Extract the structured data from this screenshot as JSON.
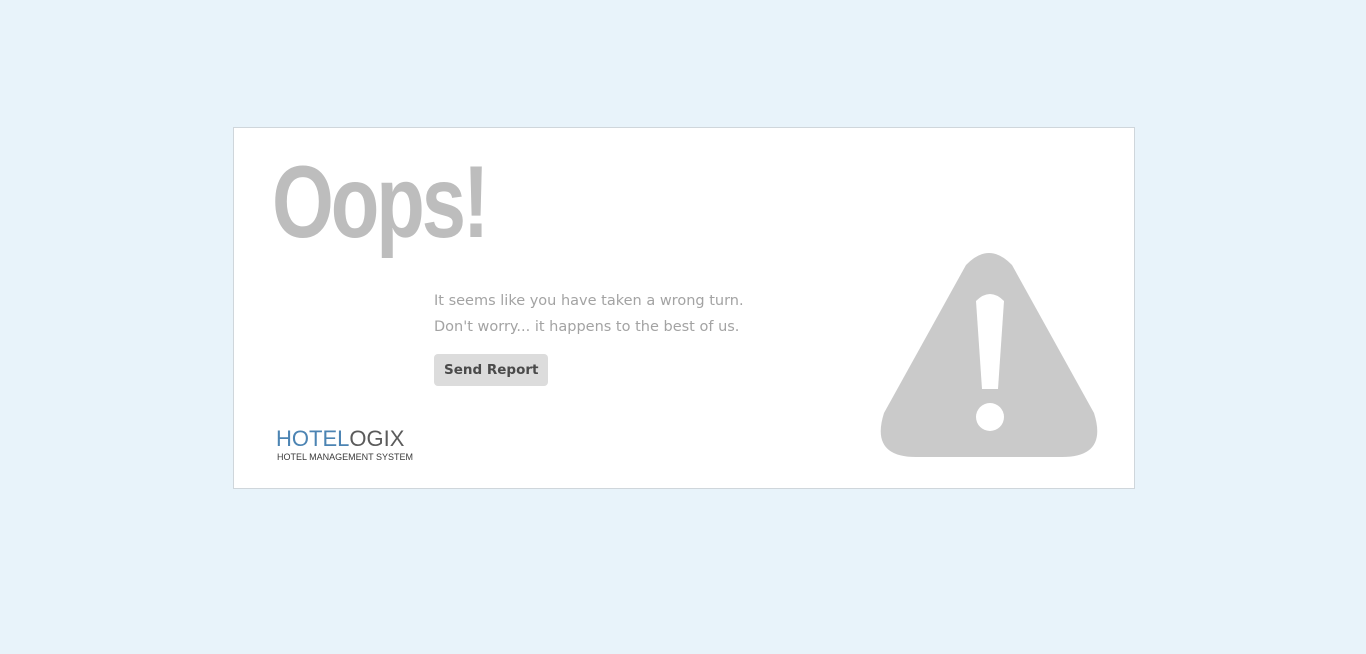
{
  "error": {
    "headline": "Oops!",
    "line1": "It seems like you have taken a wrong turn.",
    "line2": "Don't worry... it happens to the best of us.",
    "send_report_label": "Send Report"
  },
  "brand": {
    "name_part1": "HOTEL",
    "name_part2": "OGIX",
    "tagline": "HOTEL MANAGEMENT SYSTEM",
    "color_primary": "#4c84b3",
    "color_secondary": "#5b5b5b"
  },
  "icons": {
    "warning": "warning-triangle-icon"
  },
  "colors": {
    "background": "#e8f3fa",
    "card": "#ffffff",
    "headline": "#bdbdbd",
    "icon": "#cacaca",
    "button": "#dcdcdc"
  }
}
